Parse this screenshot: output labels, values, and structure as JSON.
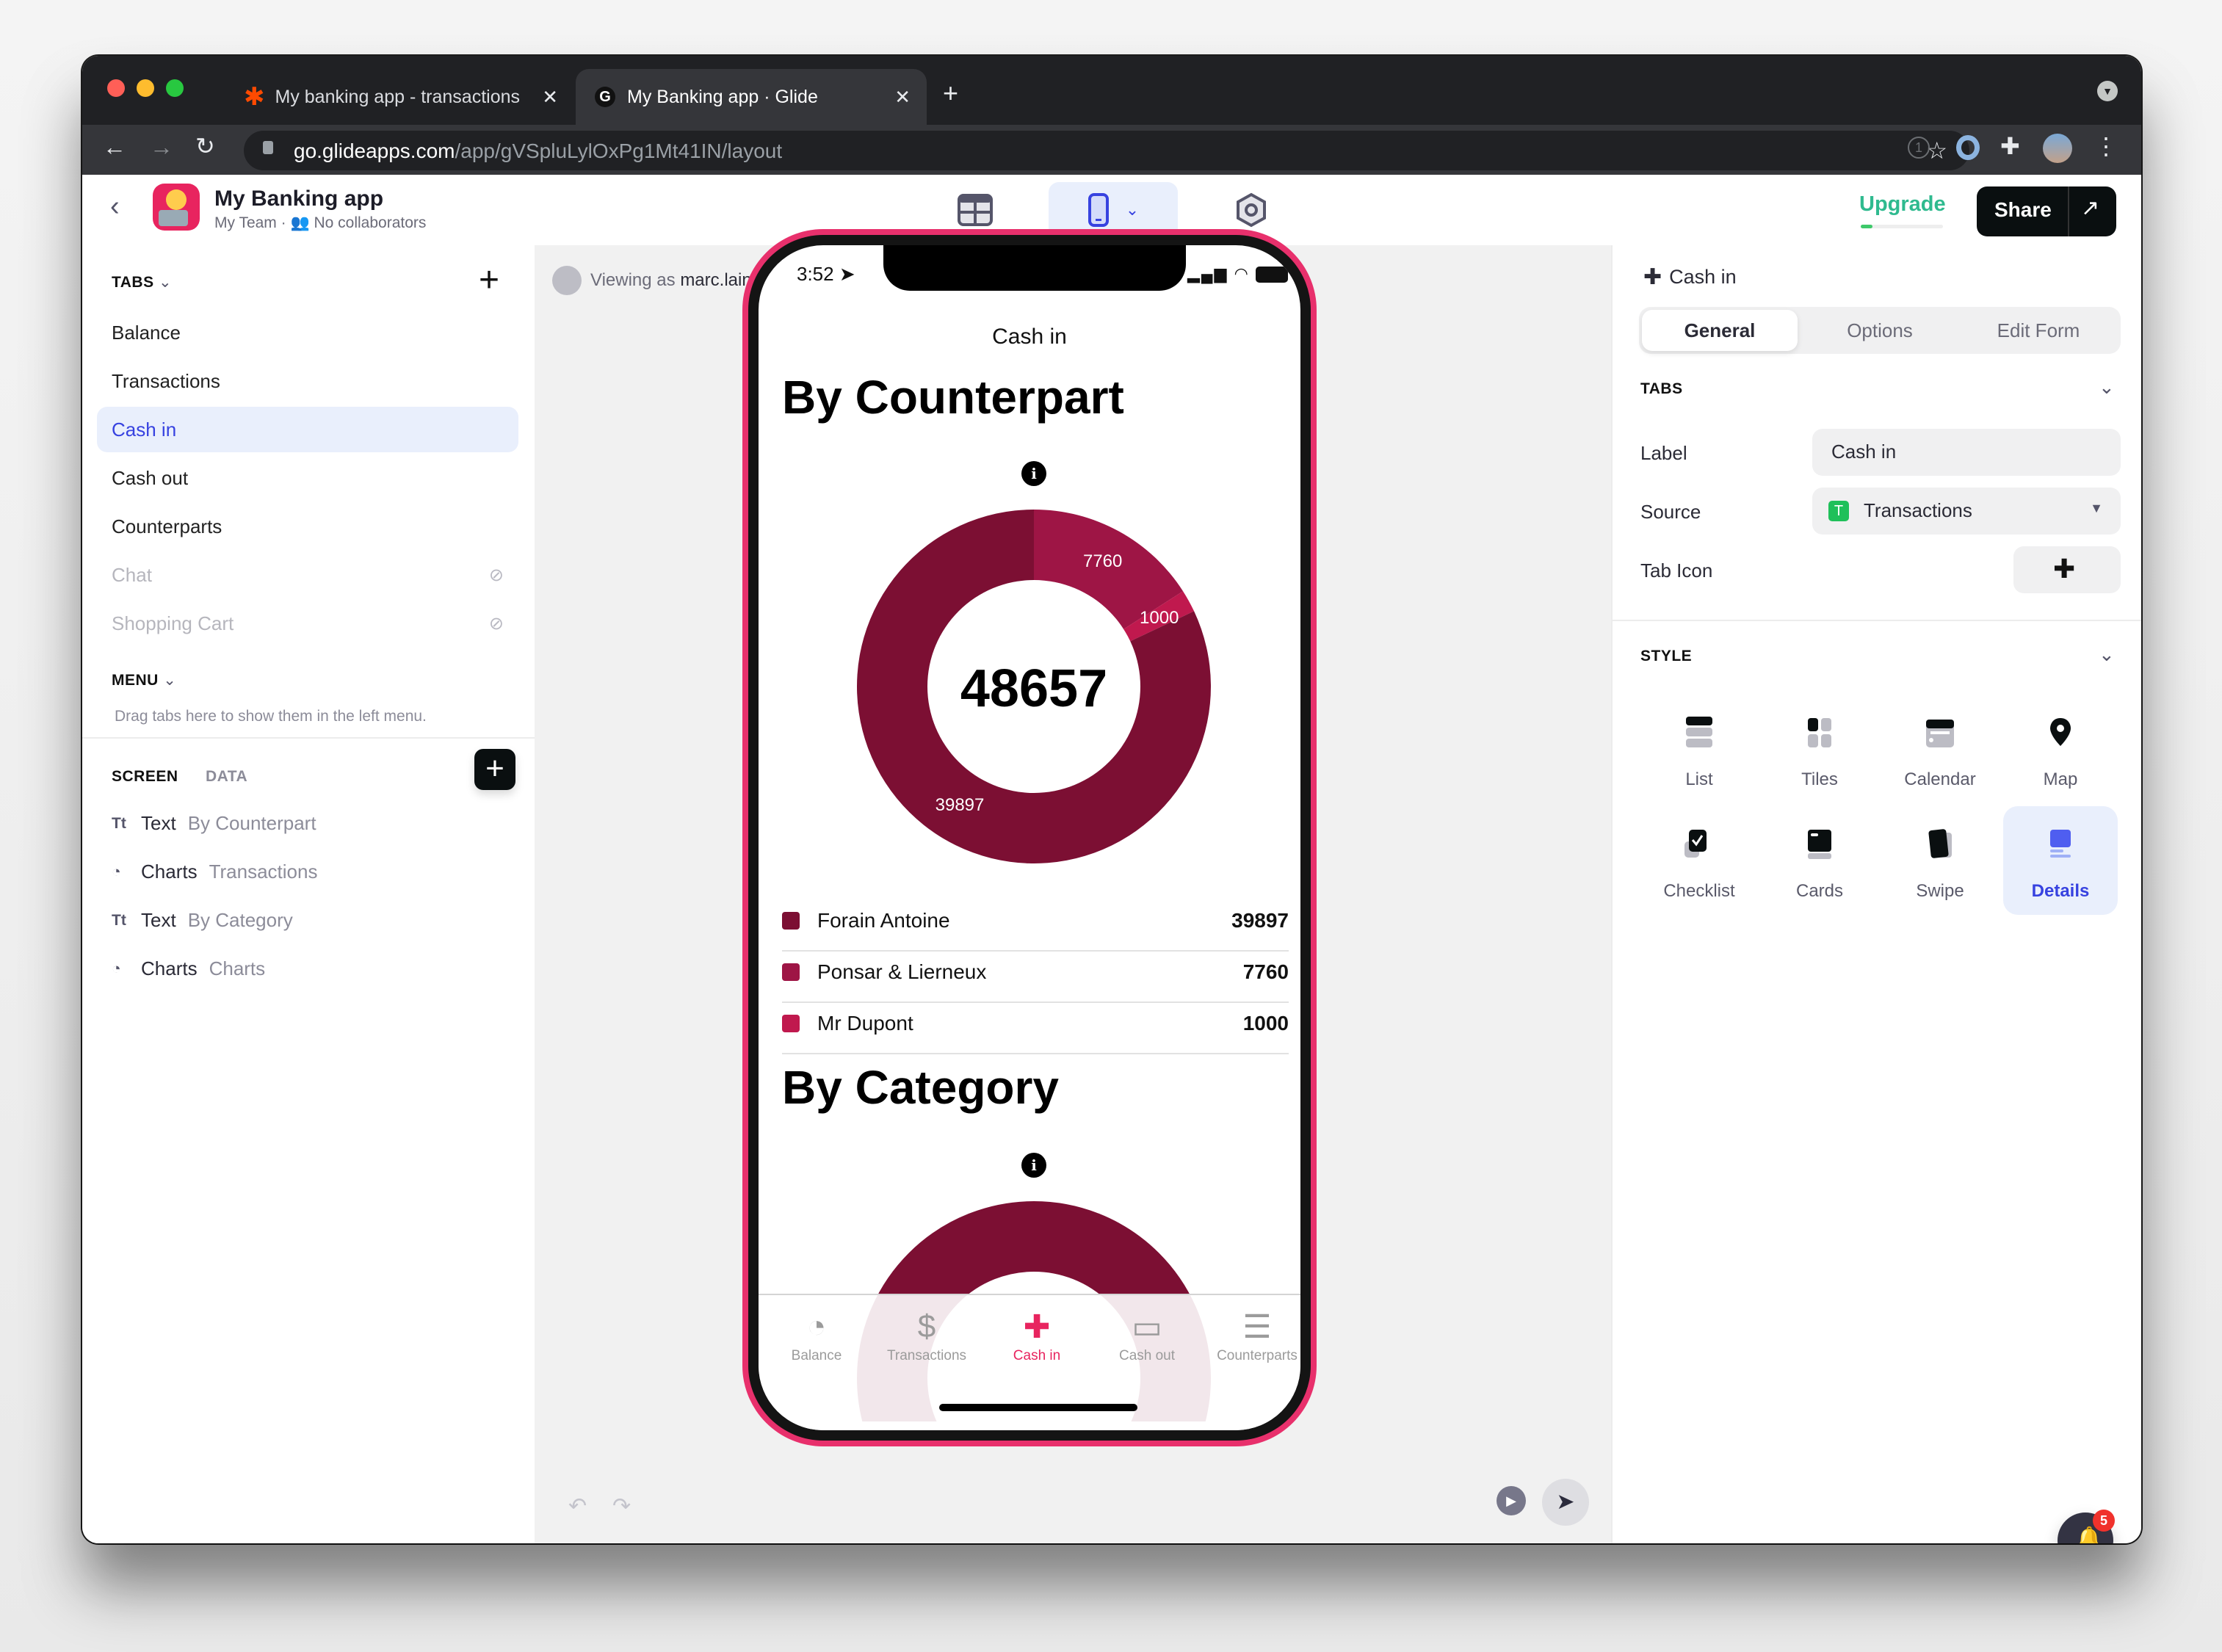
{
  "browser": {
    "tabs": [
      {
        "title": "My banking app - transactions",
        "icon": "zapier-icon",
        "active": false
      },
      {
        "title": "My Banking app · Glide",
        "icon": "glide-icon",
        "active": true
      }
    ],
    "new_tab": "+",
    "url_host": "go.glideapps.com",
    "url_path": "/app/gVSpluLylOxPg1Mt41IN/layout"
  },
  "app_header": {
    "title": "My Banking app",
    "team": "My Team",
    "collaborators": "No collaborators",
    "upgrade_label": "Upgrade",
    "upgrade_progress": 0.14,
    "share_label": "Share"
  },
  "left_panel": {
    "tabs_title": "TABS",
    "tabs": [
      {
        "label": "Balance",
        "state": "normal"
      },
      {
        "label": "Transactions",
        "state": "normal"
      },
      {
        "label": "Cash in",
        "state": "active"
      },
      {
        "label": "Cash out",
        "state": "normal"
      },
      {
        "label": "Counterparts",
        "state": "normal"
      },
      {
        "label": "Chat",
        "state": "hidden"
      },
      {
        "label": "Shopping Cart",
        "state": "hidden"
      }
    ],
    "menu_title": "MENU",
    "menu_hint": "Drag tabs here to show them in the left menu.",
    "screen_tab": "SCREEN",
    "data_tab": "DATA",
    "components": [
      {
        "icon": "Tt",
        "kind": "Text",
        "name": "By Counterpart"
      },
      {
        "icon": "chart",
        "kind": "Charts",
        "name": "Transactions"
      },
      {
        "icon": "Tt",
        "kind": "Text",
        "name": "By Category"
      },
      {
        "icon": "chart",
        "kind": "Charts",
        "name": "Charts"
      }
    ]
  },
  "canvas": {
    "viewing_prefix": "Viewing as",
    "viewing_user": "marc.lainez@g..."
  },
  "phone": {
    "time": "3:52",
    "screen_title": "Cash in",
    "heading1": "By Counterpart",
    "heading2": "By Category",
    "legend": [
      {
        "label": "Forain Antoine",
        "value": "39897"
      },
      {
        "label": "Ponsar & Lierneux",
        "value": "7760"
      },
      {
        "label": "Mr Dupont",
        "value": "1000"
      }
    ],
    "bottom_nav": [
      {
        "label": "Balance",
        "icon": "gauge-icon",
        "active": false
      },
      {
        "label": "Transactions",
        "icon": "receipt-dollar-icon",
        "active": false
      },
      {
        "label": "Cash in",
        "icon": "plus-icon",
        "active": true
      },
      {
        "label": "Cash out",
        "icon": "minus-icon",
        "active": false
      },
      {
        "label": "Counterparts",
        "icon": "list-icon",
        "active": false
      }
    ]
  },
  "chart_data": {
    "type": "pie",
    "title": "By Counterpart",
    "donut": true,
    "center_label": "48657",
    "categories": [
      "Forain Antoine",
      "Ponsar & Lierneux",
      "Mr Dupont"
    ],
    "values": [
      39897,
      7760,
      1000
    ],
    "colors": [
      "#7c0f33",
      "#9e1545",
      "#c0194e"
    ],
    "data_labels": [
      "39897",
      "7760",
      "1000"
    ],
    "legend": "bottom"
  },
  "right_panel": {
    "header": "Cash in",
    "segments": [
      "General",
      "Options",
      "Edit Form"
    ],
    "active_segment": "General",
    "tabs_section": "TABS",
    "label_label": "Label",
    "label_value": "Cash in",
    "source_label": "Source",
    "source_value": "Transactions",
    "tab_icon_label": "Tab Icon",
    "style_section": "STYLE",
    "styles": [
      {
        "label": "List",
        "active": false
      },
      {
        "label": "Tiles",
        "active": false
      },
      {
        "label": "Calendar",
        "active": false
      },
      {
        "label": "Map",
        "active": false
      },
      {
        "label": "Checklist",
        "active": false
      },
      {
        "label": "Cards",
        "active": false
      },
      {
        "label": "Swipe",
        "active": false
      },
      {
        "label": "Details",
        "active": true
      }
    ]
  },
  "notifications": {
    "count": "5"
  },
  "colors": {
    "accent": "#3742e0",
    "brand_pink": "#e8245f",
    "chart_dark": "#7c0f33"
  }
}
